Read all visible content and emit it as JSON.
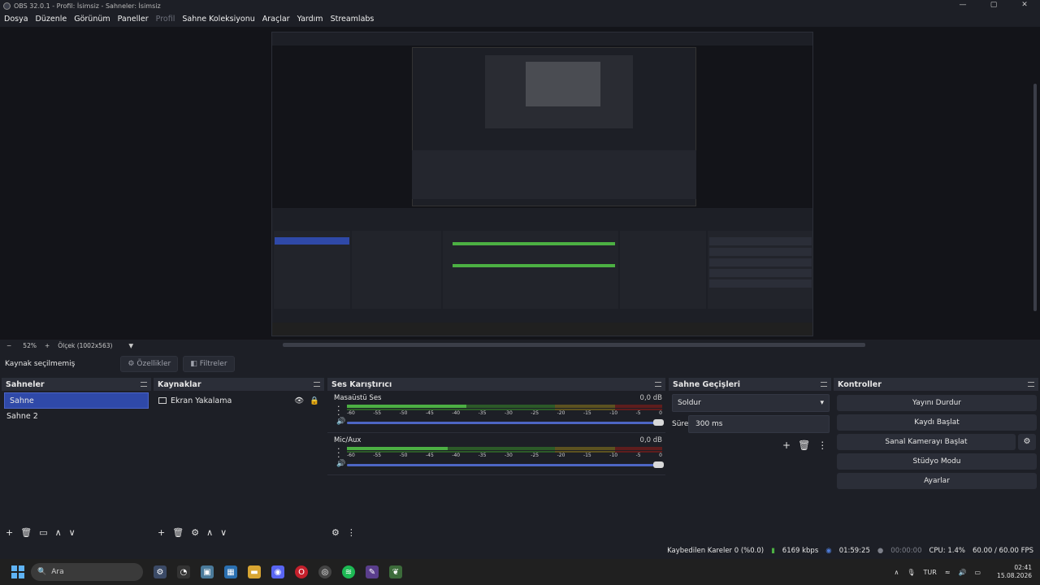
{
  "window": {
    "title": "OBS 32.0.1 - Profil: İsimsiz - Sahneler: İsimsiz",
    "controls": [
      "—",
      "▢",
      "✕"
    ]
  },
  "menu": [
    {
      "label": "Dosya",
      "enabled": true
    },
    {
      "label": "Düzenle",
      "enabled": true
    },
    {
      "label": "Görünüm",
      "enabled": true
    },
    {
      "label": "Paneller",
      "enabled": true
    },
    {
      "label": "Profil",
      "enabled": false
    },
    {
      "label": "Sahne Koleksiyonu",
      "enabled": true
    },
    {
      "label": "Araçlar",
      "enabled": true
    },
    {
      "label": "Yardım",
      "enabled": true
    },
    {
      "label": "Streamlabs",
      "enabled": true
    }
  ],
  "zoom": {
    "minus": "−",
    "percent": "52%",
    "plus": "+",
    "scale": "Ölçek (1002x563)",
    "arrow": "▼"
  },
  "context": {
    "no_source": "Kaynak seçilmemiş",
    "properties": "Özellikler",
    "filters": "Filtreler"
  },
  "scenes": {
    "title": "Sahneler",
    "items": [
      {
        "label": "Sahne",
        "selected": true
      },
      {
        "label": "Sahne 2",
        "selected": false
      }
    ],
    "footer": [
      "+",
      "🗑",
      "▭",
      "∧",
      "∨"
    ]
  },
  "sources": {
    "title": "Kaynaklar",
    "items": [
      {
        "label": "Ekran Yakalama"
      }
    ],
    "footer": [
      "+",
      "🗑",
      "⚙",
      "∧",
      "∨"
    ]
  },
  "mixer": {
    "title": "Ses Karıştırıcı",
    "ticks": [
      "-60",
      "-55",
      "-50",
      "-45",
      "-40",
      "-35",
      "-30",
      "-25",
      "-20",
      "-15",
      "-10",
      "-5",
      "0"
    ],
    "channels": [
      {
        "name": "Masaüstü Ses",
        "db": "0,0 dB",
        "level": 0.38,
        "peak": 0.34
      },
      {
        "name": "Mic/Aux",
        "db": "0,0 dB",
        "level": 0.32,
        "peak": 0.3
      }
    ],
    "footer": [
      "⚙",
      "⋮"
    ]
  },
  "transitions": {
    "title": "Sahne Geçişleri",
    "selected": "Soldur",
    "duration_label": "Süre",
    "duration_value": "300 ms",
    "buttons": [
      "+",
      "🗑",
      "⋮"
    ]
  },
  "controls": {
    "title": "Kontroller",
    "buttons": [
      "Yayını Durdur",
      "Kaydı Başlat",
      "Sanal Kamerayı Başlat",
      "Stüdyo Modu",
      "Ayarlar"
    ]
  },
  "status": {
    "dropped": "Kaybedilen Kareler 0 (%0.0)",
    "bitrate": "6169 kbps",
    "stream_time": "01:59:25",
    "rec_time": "00:00:00",
    "cpu": "CPU: 1.4%",
    "fps": "60.00 / 60.00 FPS"
  },
  "taskbar": {
    "search_placeholder": "Ara",
    "lang": "TUR",
    "time": "02:41",
    "date": "15.08.2026"
  },
  "colors": {
    "accent": "#2f49a8",
    "meter_green": "#4cb043",
    "meter_yellow": "#9c8a2d",
    "meter_red": "#a32b2b"
  }
}
